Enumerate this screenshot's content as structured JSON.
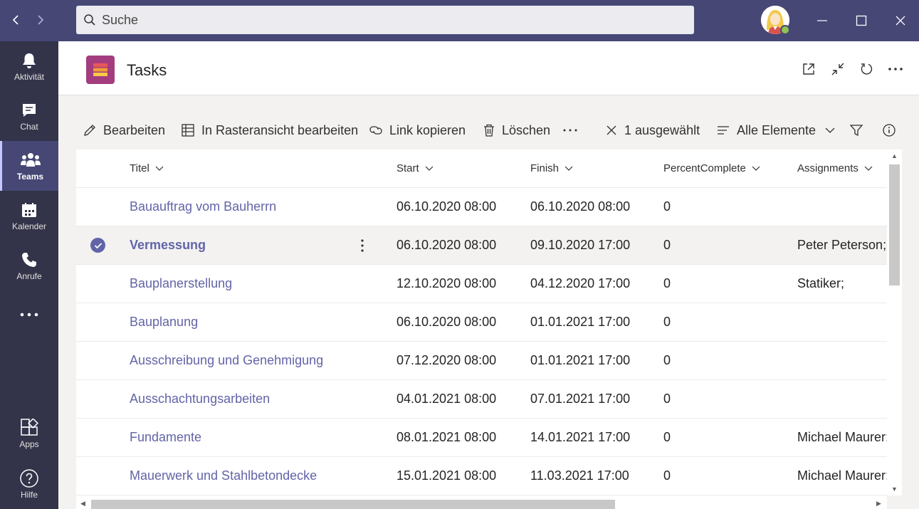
{
  "search": {
    "placeholder": "Suche"
  },
  "rail": [
    {
      "label": "Aktivität",
      "icon": "bell-icon"
    },
    {
      "label": "Chat",
      "icon": "chat-icon"
    },
    {
      "label": "Teams",
      "icon": "teams-icon",
      "active": true
    },
    {
      "label": "Kalender",
      "icon": "calendar-icon"
    },
    {
      "label": "Anrufe",
      "icon": "phone-icon"
    },
    {
      "label": "",
      "icon": "more-icon"
    },
    {
      "label": "Apps",
      "icon": "apps-icon"
    },
    {
      "label": "Hilfe",
      "icon": "help-icon"
    }
  ],
  "app": {
    "title": "Tasks",
    "accent": "#a33d7f"
  },
  "commands": {
    "edit": "Bearbeiten",
    "grid_edit": "In Rasteransicht bearbeiten",
    "copy_link": "Link kopieren",
    "delete": "Löschen",
    "selected": "1 ausgewählt",
    "view": "Alle Elemente"
  },
  "columns": {
    "title": "Titel",
    "start": "Start",
    "finish": "Finish",
    "percent": "PercentComplete",
    "assignments": "Assignments"
  },
  "rows": [
    {
      "title": "Bauauftrag vom Bauherrn",
      "start": "06.10.2020 08:00",
      "finish": "06.10.2020 08:00",
      "percent": "0",
      "assignments": ""
    },
    {
      "title": "Vermessung",
      "start": "06.10.2020 08:00",
      "finish": "09.10.2020 17:00",
      "percent": "0",
      "assignments": "Peter Peterson;",
      "selected": true
    },
    {
      "title": "Bauplanerstellung",
      "start": "12.10.2020 08:00",
      "finish": "04.12.2020 17:00",
      "percent": "0",
      "assignments": "Statiker;"
    },
    {
      "title": "Bauplanung",
      "start": "06.10.2020 08:00",
      "finish": "01.01.2021 17:00",
      "percent": "0",
      "assignments": ""
    },
    {
      "title": "Ausschreibung und Genehmigung",
      "start": "07.12.2020 08:00",
      "finish": "01.01.2021 17:00",
      "percent": "0",
      "assignments": ""
    },
    {
      "title": "Ausschachtungsarbeiten",
      "start": "04.01.2021 08:00",
      "finish": "07.01.2021 17:00",
      "percent": "0",
      "assignments": ""
    },
    {
      "title": "Fundamente",
      "start": "08.01.2021 08:00",
      "finish": "14.01.2021 17:00",
      "percent": "0",
      "assignments": "Michael Maurer;"
    },
    {
      "title": "Mauerwerk und Stahlbetondecke",
      "start": "15.01.2021 08:00",
      "finish": "11.03.2021 17:00",
      "percent": "0",
      "assignments": "Michael Maurer;"
    }
  ],
  "colors": {
    "titlebar": "#464775",
    "rail": "#33344a",
    "link": "#6264a7",
    "presence": "#92c353"
  }
}
